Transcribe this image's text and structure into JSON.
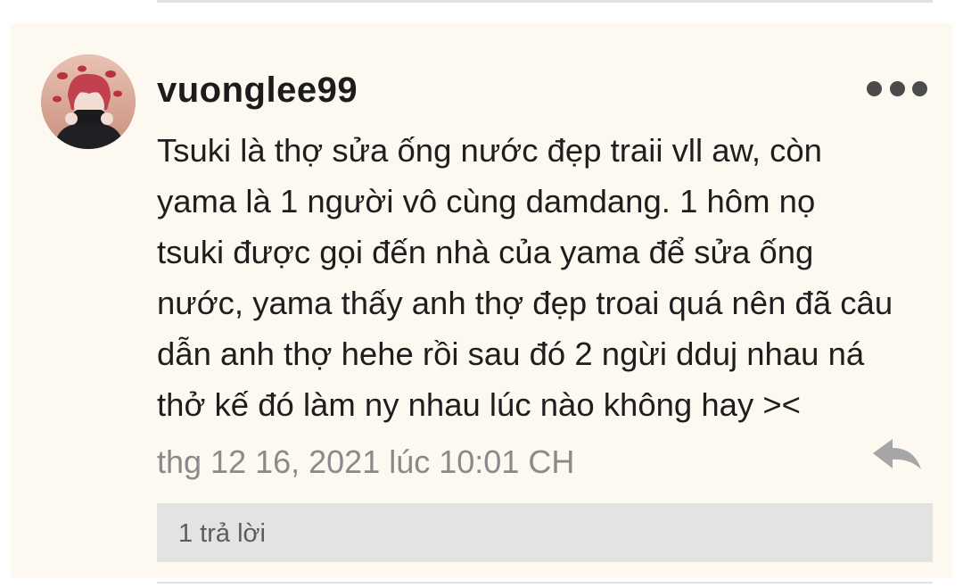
{
  "comment": {
    "username": "vuonglee99",
    "text": "Tsuki là thợ sửa ống nước đẹp traii vll aw, còn\nyama là 1 người vô cùng damdang. 1 hôm nọ\ntsuki được gọi đến nhà của yama để sửa ống\nnước, yama thấy anh thợ đẹp troai quá nên đã câu\ndẫn anh thợ hehe rồi sau đó 2 ngừi dduj nhau ná\nthở kế đó làm ny nhau lúc nào không hay ><",
    "timestamp": "thg 12 16, 2021 lúc 10:01 CH",
    "replies_label": "1 trả lời",
    "avatar_icon": "user-avatar-icon",
    "more_icon": "more-horizontal-icon",
    "reply_icon": "reply-arrow-icon"
  },
  "colors": {
    "card_background": "#fdf9f1",
    "text": "#1e1e1e",
    "muted": "#8a8a8a",
    "replies_bar": "#e3e3e1",
    "icon": "#4b4b4b"
  }
}
